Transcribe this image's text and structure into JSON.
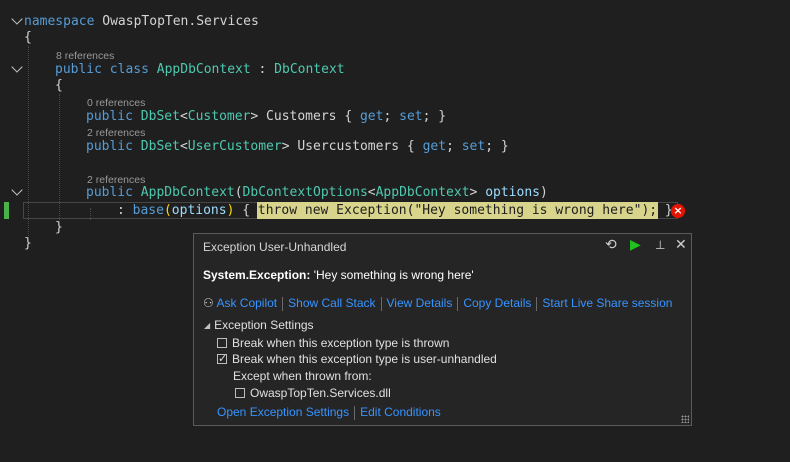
{
  "editor": {
    "code_lines": {
      "namespace_kw": "namespace",
      "namespace_name": "OwaspTopTen.Services",
      "open_brace_1": "{",
      "lens_class": "8 references",
      "class_public": "public",
      "class_kw": "class",
      "class_name": "AppDbContext",
      "class_colon": ":",
      "class_base": "DbContext",
      "open_brace_2": "{",
      "lens_customers": "0 references",
      "customers_public": "public",
      "customers_type": "DbSet",
      "customers_generic_open": "<",
      "customers_generic": "Customer",
      "customers_generic_close": ">",
      "customers_name": "Customers",
      "customers_accessors_open": "{",
      "customers_get": "get",
      "customers_semi1": ";",
      "customers_set": "set",
      "customers_semi2": ";",
      "customers_accessors_close": "}",
      "lens_usercustomers": "2 references",
      "usercustomers_public": "public",
      "usercustomers_type": "DbSet",
      "usercustomers_generic_open": "<",
      "usercustomers_generic": "UserCustomer",
      "usercustomers_generic_close": ">",
      "usercustomers_name": "Usercustomers",
      "usercustomers_accessors_open": "{",
      "usercustomers_get": "get",
      "usercustomers_semi1": ";",
      "usercustomers_set": "set",
      "usercustomers_semi2": ";",
      "usercustomers_accessors_close": "}",
      "lens_ctor": "2 references",
      "ctor_public": "public",
      "ctor_name": "AppDbContext",
      "ctor_paren_open": "(",
      "ctor_param_type": "DbContextOptions",
      "ctor_param_generic_open": "<",
      "ctor_param_generic": "AppDbContext",
      "ctor_param_generic_close": ">",
      "ctor_param_name": "options",
      "ctor_paren_close": ")",
      "base_colon": ":",
      "base_kw": "base",
      "base_paren_open": "(",
      "base_arg": "options",
      "base_paren_close": ")",
      "body_open": "{",
      "throw_statement_prefix": "throw new Exception(",
      "throw_message": "\"Hey something is wrong here\"",
      "throw_statement_suffix": ");",
      "body_close": "}",
      "close_brace_2": "}",
      "close_brace_1": "}"
    }
  },
  "exception_popup": {
    "title": "Exception User-Unhandled",
    "icons": [
      "history-icon",
      "continue-icon",
      "pin-icon",
      "close-icon"
    ],
    "exception_type": "System.Exception:",
    "exception_message": "'Hey something is wrong here'",
    "links": {
      "ask_copilot": "Ask Copilot",
      "show_call_stack": "Show Call Stack",
      "view_details": "View Details",
      "copy_details": "Copy Details",
      "live_share": "Start Live Share session"
    },
    "settings": {
      "header": "Exception Settings",
      "break_thrown": {
        "label": "Break when this exception type is thrown",
        "checked": false
      },
      "break_unhandled": {
        "label": "Break when this exception type is user-unhandled",
        "checked": true
      },
      "except_label": "Except when thrown from:",
      "dll": {
        "label": "OwaspTopTen.Services.dll",
        "checked": false
      }
    },
    "bottom_links": {
      "open_settings": "Open Exception Settings",
      "edit_conditions": "Edit Conditions"
    }
  },
  "colors": {
    "background": "#1f1f1f",
    "keyword": "#569cd6",
    "type": "#4ec9b0",
    "string_highlight": "#d8d48b",
    "link": "#3794ff",
    "error": "#e51400",
    "breakpoint_marker": "#49b249"
  }
}
